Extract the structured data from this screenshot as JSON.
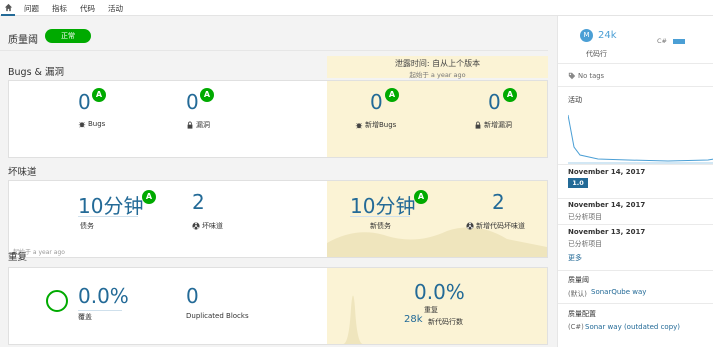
{
  "nav": {
    "home_icon": "home-icon",
    "tabs": [
      "问题",
      "指标",
      "代码",
      "活动"
    ]
  },
  "quality_gate": {
    "title": "质量阈",
    "status": "正常"
  },
  "leak_header": {
    "title": "泄露时间: 自从上个版本",
    "since": "起始于 a year ago"
  },
  "bugs": {
    "title": "Bugs & 漏洞",
    "bugs_value": "0",
    "bugs_rating": "A",
    "bugs_label": "Bugs",
    "vuln_value": "0",
    "vuln_rating": "A",
    "vuln_label": "漏洞",
    "new_bugs_value": "0",
    "new_bugs_rating": "A",
    "new_bugs_label": "新增Bugs",
    "new_vuln_value": "0",
    "new_vuln_rating": "A",
    "new_vuln_label": "新增漏洞"
  },
  "smells": {
    "title": "坏味道",
    "debt_value": "10分钟",
    "debt_rating": "A",
    "debt_label": "债务",
    "smells_value": "2",
    "smells_label": "坏味道",
    "new_debt_value": "10分钟",
    "new_debt_rating": "A",
    "new_debt_label": "新债务",
    "new_smells_value": "2",
    "new_smells_label": "新增代码坏味道",
    "since": "起始于 a year ago"
  },
  "duplications": {
    "title": "重复",
    "coverage_value": "0.0%",
    "coverage_label": "覆盖",
    "dup_blocks_value": "0",
    "dup_blocks_label": "Duplicated Blocks",
    "new_dup_value": "0.0%",
    "new_dup_label": "重复",
    "new_lines_value": "28k",
    "new_lines_label": "新代码行数"
  },
  "sidebar": {
    "avatar_letter": "M",
    "loc_value": "24k",
    "loc_label": "代码行",
    "lang_name": "C#",
    "lang_share": 0.6,
    "no_tags": "No tags",
    "activity_title": "活动",
    "events": [
      {
        "date": "November 14, 2017",
        "version": "1.0"
      },
      {
        "date": "November 14, 2017",
        "note": "已分析项目"
      },
      {
        "date": "November 13, 2017",
        "note": "已分析项目"
      }
    ],
    "more_link": "更多",
    "qg_title": "质量阈",
    "qg_prefix": "(默认)",
    "qg_value": "SonarQube way",
    "qp_title": "质量配置",
    "qp_prefix": "(C#)",
    "qp_value": "Sonar way (outdated copy)"
  },
  "colors": {
    "accent": "#236a97",
    "ok": "#00aa00",
    "leak": "#fbf3d5",
    "chart": "#4b9fd5"
  }
}
